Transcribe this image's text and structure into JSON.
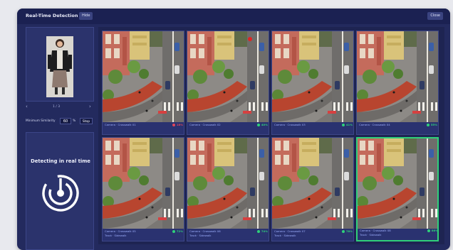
{
  "window": {
    "title": "Real-Time Detection",
    "hide_label": "Hide",
    "close_label": "Close"
  },
  "reference": {
    "pager": "1 / 3"
  },
  "similarity": {
    "label": "Minimum Similarity",
    "value": "60",
    "unit": "%",
    "stop_label": "Stop"
  },
  "detect": {
    "text": "Detecting in real time",
    "icon": "radar-icon"
  },
  "colors": {
    "match_high": "#2fd07a",
    "match_low": "#e0475b",
    "accent": "#3a4380"
  },
  "cameras": [
    {
      "line1": "Camera · Crosswalk 01",
      "line2": "",
      "match": "18%",
      "status": "low"
    },
    {
      "line1": "Camera · Crosswalk 02",
      "line2": "",
      "match": "40%",
      "status": "high"
    },
    {
      "line1": "Camera · Crosswalk 03",
      "line2": "",
      "match": "41%",
      "status": "high"
    },
    {
      "line1": "Camera · Crosswalk 04",
      "line2": "",
      "match": "55%",
      "status": "high"
    },
    {
      "line1": "Camera · Crosswalk 05",
      "line2": "Track · Sidewalk",
      "match": "72%",
      "status": "high"
    },
    {
      "line1": "Camera · Crosswalk 06",
      "line2": "Track · Sidewalk",
      "match": "74%",
      "status": "high"
    },
    {
      "line1": "Camera · Crosswalk 07",
      "line2": "Track · Sidewalk",
      "match": "78%",
      "status": "high"
    },
    {
      "line1": "Camera · Crosswalk 08",
      "line2": "Track · Sidewalk",
      "match": "86%",
      "status": "high"
    }
  ]
}
